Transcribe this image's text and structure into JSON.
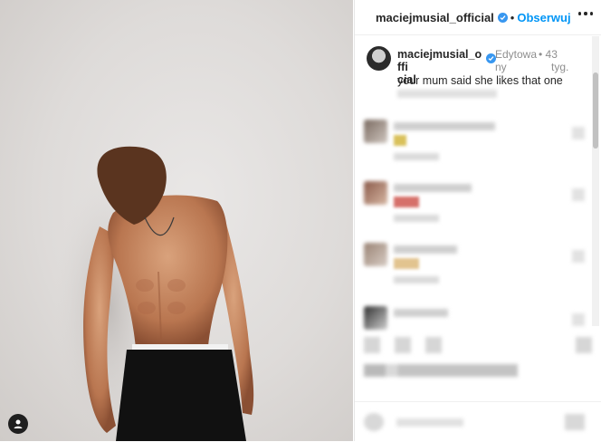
{
  "post_header": {
    "username": "maciejmusial_official",
    "separator": "•",
    "follow_label": "Obserwuj"
  },
  "caption": {
    "username_line1": "maciejmusial_offi",
    "username_line2": "cial",
    "edited_line1": "Edytowa",
    "edited_line2": "ny",
    "age_dot": "•",
    "age_line1": "43",
    "age_line2": "tyg.",
    "text": "your mum said she likes that one"
  },
  "icons": {
    "verified": "verified-badge-icon",
    "more": "more-options-icon",
    "user_tag": "user-tag-icon",
    "like": "heart-icon",
    "comment": "comment-icon",
    "share": "share-icon",
    "save": "bookmark-icon",
    "emoji": "emoji-icon"
  },
  "colors": {
    "accent": "#0095f6",
    "verified": "#3897f0",
    "text": "#262626",
    "muted": "#8e8e8e"
  }
}
